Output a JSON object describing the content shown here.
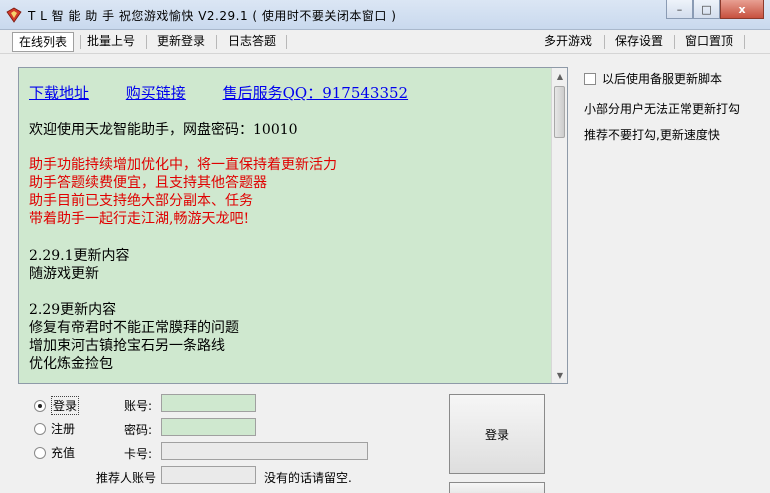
{
  "window": {
    "title": "T L 智 能 助 手 祝您游戏愉快 V2.29.1 ( 使用时不要关闭本窗口 )",
    "minimize": "–",
    "maximize": "□",
    "close": "x"
  },
  "menu": {
    "left": [
      "在线列表",
      "批量上号",
      "更新登录",
      "日志答题"
    ],
    "right": [
      "多开游戏",
      "保存设置",
      "窗口置顶"
    ]
  },
  "content": {
    "links": [
      "下载地址",
      "购买链接",
      "售后服务QQ：917543352"
    ],
    "welcome": "欢迎使用天龙智能助手，网盘密码：10010",
    "notice_lines": [
      " 助手功能持续增加优化中，将一直保持着更新活力",
      "助手答题续费便宜，且支持其他答题器",
      "助手目前已支持绝大部分副本、任务",
      "带着助手一起行走江湖,畅游天龙吧!"
    ],
    "update1_lines": [
      "2.29.1更新内容",
      "随游戏更新"
    ],
    "update2_lines": [
      "2.29更新内容",
      "修复有帝君时不能正常膜拜的问题",
      "增加束河古镇抢宝石另一条路线",
      "优化炼金捡包"
    ]
  },
  "options": {
    "backup_script_label": "以后使用备服更新脚本",
    "note1": "小部分用户无法正常更新打勾",
    "note2": "推荐不要打勾,更新速度快"
  },
  "login": {
    "modes": [
      "登录",
      "注册",
      "充值"
    ],
    "selected_mode": "登录",
    "account_label": "账号:",
    "password_label": "密码:",
    "card_label": "卡号:",
    "referrer_label": "推荐人账号",
    "referrer_hint": "没有的话请留空.",
    "login_button": "登录"
  },
  "colors": {
    "content_bg": "#cfe8cf",
    "link": "#0000ee",
    "notice": "#e00000"
  }
}
